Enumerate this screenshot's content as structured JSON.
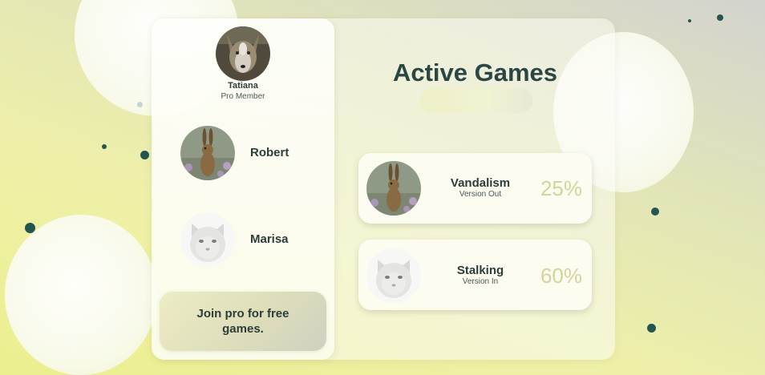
{
  "profile": {
    "name": "Tatiana",
    "role": "Pro Member",
    "avatar_icon": "wolf-avatar"
  },
  "friends": [
    {
      "name": "Robert",
      "avatar_icon": "hare-avatar"
    },
    {
      "name": "Marisa",
      "avatar_icon": "white-cat-avatar"
    }
  ],
  "promo": {
    "label": "Join pro for free games."
  },
  "main": {
    "title": "Active Games"
  },
  "games": [
    {
      "title": "Vandalism",
      "subtitle": "Version Out",
      "progress": "25%",
      "avatar_icon": "hare-avatar"
    },
    {
      "title": "Stalking",
      "subtitle": "Version In",
      "progress": "60%",
      "avatar_icon": "white-cat-avatar"
    }
  ],
  "colors": {
    "accent_text": "#2a4744",
    "progress_text": "#d3d39c",
    "dot": "#245551"
  }
}
